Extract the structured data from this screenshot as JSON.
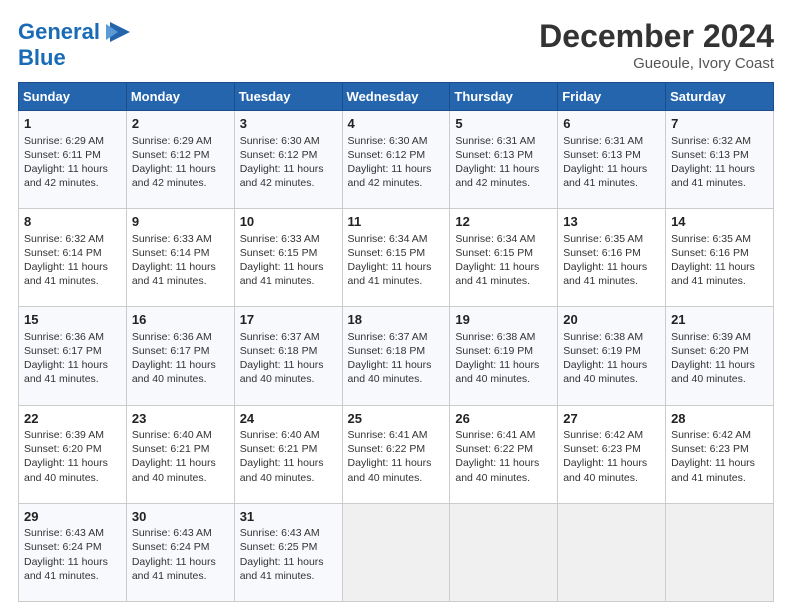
{
  "header": {
    "logo_line1": "General",
    "logo_line2": "Blue",
    "title": "December 2024",
    "location": "Gueoule, Ivory Coast"
  },
  "weekdays": [
    "Sunday",
    "Monday",
    "Tuesday",
    "Wednesday",
    "Thursday",
    "Friday",
    "Saturday"
  ],
  "weeks": [
    [
      {
        "day": "1",
        "lines": [
          "Sunrise: 6:29 AM",
          "Sunset: 6:11 PM",
          "Daylight: 11 hours",
          "and 42 minutes."
        ]
      },
      {
        "day": "2",
        "lines": [
          "Sunrise: 6:29 AM",
          "Sunset: 6:12 PM",
          "Daylight: 11 hours",
          "and 42 minutes."
        ]
      },
      {
        "day": "3",
        "lines": [
          "Sunrise: 6:30 AM",
          "Sunset: 6:12 PM",
          "Daylight: 11 hours",
          "and 42 minutes."
        ]
      },
      {
        "day": "4",
        "lines": [
          "Sunrise: 6:30 AM",
          "Sunset: 6:12 PM",
          "Daylight: 11 hours",
          "and 42 minutes."
        ]
      },
      {
        "day": "5",
        "lines": [
          "Sunrise: 6:31 AM",
          "Sunset: 6:13 PM",
          "Daylight: 11 hours",
          "and 42 minutes."
        ]
      },
      {
        "day": "6",
        "lines": [
          "Sunrise: 6:31 AM",
          "Sunset: 6:13 PM",
          "Daylight: 11 hours",
          "and 41 minutes."
        ]
      },
      {
        "day": "7",
        "lines": [
          "Sunrise: 6:32 AM",
          "Sunset: 6:13 PM",
          "Daylight: 11 hours",
          "and 41 minutes."
        ]
      }
    ],
    [
      {
        "day": "8",
        "lines": [
          "Sunrise: 6:32 AM",
          "Sunset: 6:14 PM",
          "Daylight: 11 hours",
          "and 41 minutes."
        ]
      },
      {
        "day": "9",
        "lines": [
          "Sunrise: 6:33 AM",
          "Sunset: 6:14 PM",
          "Daylight: 11 hours",
          "and 41 minutes."
        ]
      },
      {
        "day": "10",
        "lines": [
          "Sunrise: 6:33 AM",
          "Sunset: 6:15 PM",
          "Daylight: 11 hours",
          "and 41 minutes."
        ]
      },
      {
        "day": "11",
        "lines": [
          "Sunrise: 6:34 AM",
          "Sunset: 6:15 PM",
          "Daylight: 11 hours",
          "and 41 minutes."
        ]
      },
      {
        "day": "12",
        "lines": [
          "Sunrise: 6:34 AM",
          "Sunset: 6:15 PM",
          "Daylight: 11 hours",
          "and 41 minutes."
        ]
      },
      {
        "day": "13",
        "lines": [
          "Sunrise: 6:35 AM",
          "Sunset: 6:16 PM",
          "Daylight: 11 hours",
          "and 41 minutes."
        ]
      },
      {
        "day": "14",
        "lines": [
          "Sunrise: 6:35 AM",
          "Sunset: 6:16 PM",
          "Daylight: 11 hours",
          "and 41 minutes."
        ]
      }
    ],
    [
      {
        "day": "15",
        "lines": [
          "Sunrise: 6:36 AM",
          "Sunset: 6:17 PM",
          "Daylight: 11 hours",
          "and 41 minutes."
        ]
      },
      {
        "day": "16",
        "lines": [
          "Sunrise: 6:36 AM",
          "Sunset: 6:17 PM",
          "Daylight: 11 hours",
          "and 40 minutes."
        ]
      },
      {
        "day": "17",
        "lines": [
          "Sunrise: 6:37 AM",
          "Sunset: 6:18 PM",
          "Daylight: 11 hours",
          "and 40 minutes."
        ]
      },
      {
        "day": "18",
        "lines": [
          "Sunrise: 6:37 AM",
          "Sunset: 6:18 PM",
          "Daylight: 11 hours",
          "and 40 minutes."
        ]
      },
      {
        "day": "19",
        "lines": [
          "Sunrise: 6:38 AM",
          "Sunset: 6:19 PM",
          "Daylight: 11 hours",
          "and 40 minutes."
        ]
      },
      {
        "day": "20",
        "lines": [
          "Sunrise: 6:38 AM",
          "Sunset: 6:19 PM",
          "Daylight: 11 hours",
          "and 40 minutes."
        ]
      },
      {
        "day": "21",
        "lines": [
          "Sunrise: 6:39 AM",
          "Sunset: 6:20 PM",
          "Daylight: 11 hours",
          "and 40 minutes."
        ]
      }
    ],
    [
      {
        "day": "22",
        "lines": [
          "Sunrise: 6:39 AM",
          "Sunset: 6:20 PM",
          "Daylight: 11 hours",
          "and 40 minutes."
        ]
      },
      {
        "day": "23",
        "lines": [
          "Sunrise: 6:40 AM",
          "Sunset: 6:21 PM",
          "Daylight: 11 hours",
          "and 40 minutes."
        ]
      },
      {
        "day": "24",
        "lines": [
          "Sunrise: 6:40 AM",
          "Sunset: 6:21 PM",
          "Daylight: 11 hours",
          "and 40 minutes."
        ]
      },
      {
        "day": "25",
        "lines": [
          "Sunrise: 6:41 AM",
          "Sunset: 6:22 PM",
          "Daylight: 11 hours",
          "and 40 minutes."
        ]
      },
      {
        "day": "26",
        "lines": [
          "Sunrise: 6:41 AM",
          "Sunset: 6:22 PM",
          "Daylight: 11 hours",
          "and 40 minutes."
        ]
      },
      {
        "day": "27",
        "lines": [
          "Sunrise: 6:42 AM",
          "Sunset: 6:23 PM",
          "Daylight: 11 hours",
          "and 40 minutes."
        ]
      },
      {
        "day": "28",
        "lines": [
          "Sunrise: 6:42 AM",
          "Sunset: 6:23 PM",
          "Daylight: 11 hours",
          "and 41 minutes."
        ]
      }
    ],
    [
      {
        "day": "29",
        "lines": [
          "Sunrise: 6:43 AM",
          "Sunset: 6:24 PM",
          "Daylight: 11 hours",
          "and 41 minutes."
        ]
      },
      {
        "day": "30",
        "lines": [
          "Sunrise: 6:43 AM",
          "Sunset: 6:24 PM",
          "Daylight: 11 hours",
          "and 41 minutes."
        ]
      },
      {
        "day": "31",
        "lines": [
          "Sunrise: 6:43 AM",
          "Sunset: 6:25 PM",
          "Daylight: 11 hours",
          "and 41 minutes."
        ]
      },
      null,
      null,
      null,
      null
    ]
  ]
}
